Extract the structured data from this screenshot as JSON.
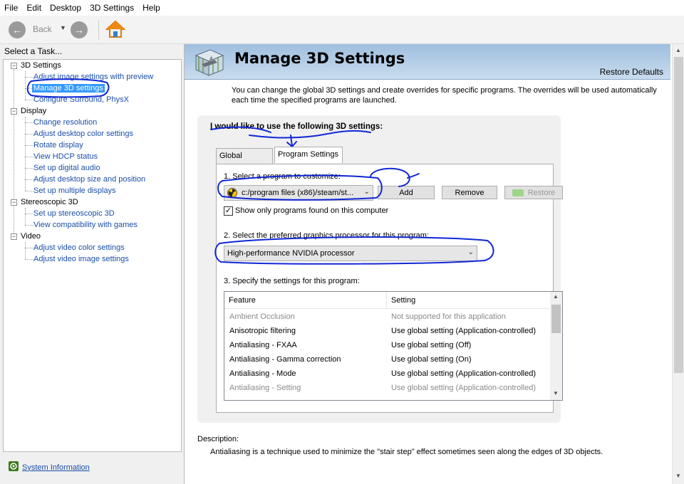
{
  "menu": {
    "items": [
      "File",
      "Edit",
      "Desktop",
      "3D Settings",
      "Help"
    ]
  },
  "toolbar": {
    "back_label": "Back",
    "icons": [
      "back-arrow-icon",
      "dropdown-arrow-icon",
      "forward-arrow-icon",
      "home-icon"
    ]
  },
  "left": {
    "task_label": "Select a Task...",
    "tree": [
      {
        "label": "3D Settings",
        "items": [
          "Adjust image settings with preview",
          "Manage 3D settings",
          "Configure Surround, PhysX"
        ]
      },
      {
        "label": "Display",
        "items": [
          "Change resolution",
          "Adjust desktop color settings",
          "Rotate display",
          "View HDCP status",
          "Set up digital audio",
          "Adjust desktop size and position",
          "Set up multiple displays"
        ]
      },
      {
        "label": "Stereoscopic 3D",
        "items": [
          "Set up stereoscopic 3D",
          "View compatibility with games"
        ]
      },
      {
        "label": "Video",
        "items": [
          "Adjust video color settings",
          "Adjust video image settings"
        ]
      }
    ],
    "selected": "Manage 3D settings",
    "system_info": "System Information"
  },
  "main": {
    "title": "Manage 3D Settings",
    "restore_defaults": "Restore Defaults",
    "intro": "You can change the global 3D settings and create overrides for specific programs. The overrides will be used automatically each time the specified programs are launched.",
    "heading": "I would like to use the following 3D settings:",
    "tabs": [
      {
        "label": "Global Settings",
        "active": false
      },
      {
        "label": "Program Settings",
        "active": true
      }
    ],
    "step1_label": "1. Select a program to customize:",
    "program_value": "c:/program files (x86)/steam/st...",
    "add_button": "Add",
    "remove_button": "Remove",
    "restore_button": "Restore",
    "show_only_checkbox": {
      "label": "Show only programs found on this computer",
      "checked": true
    },
    "step2_label": "2. Select the preferred graphics processor for this program:",
    "gpu_value": "High-performance NVIDIA processor",
    "step3_label": "3. Specify the settings for this program:",
    "grid": {
      "columns": [
        "Feature",
        "Setting"
      ],
      "rows": [
        {
          "feature": "Ambient Occlusion",
          "setting": "Not supported for this application",
          "dim": true
        },
        {
          "feature": "Anisotropic filtering",
          "setting": "Use global setting (Application-controlled)",
          "dim": false
        },
        {
          "feature": "Antialiasing - FXAA",
          "setting": "Use global setting (Off)",
          "dim": false
        },
        {
          "feature": "Antialiasing - Gamma correction",
          "setting": "Use global setting (On)",
          "dim": false
        },
        {
          "feature": "Antialiasing - Mode",
          "setting": "Use global setting (Application-controlled)",
          "dim": false
        },
        {
          "feature": "Antialiasing - Setting",
          "setting": "Use global setting (Application-controlled)",
          "dim": true
        }
      ]
    },
    "description_label": "Description:",
    "description_text": "Antialiasing is a technique used to minimize the \"stair step\" effect sometimes seen along the edges of 3D objects."
  },
  "colors": {
    "link": "#1a4fa8",
    "selection": "#3399ff",
    "annotation": "#1027d6",
    "header_band": "#9fbfdf"
  }
}
